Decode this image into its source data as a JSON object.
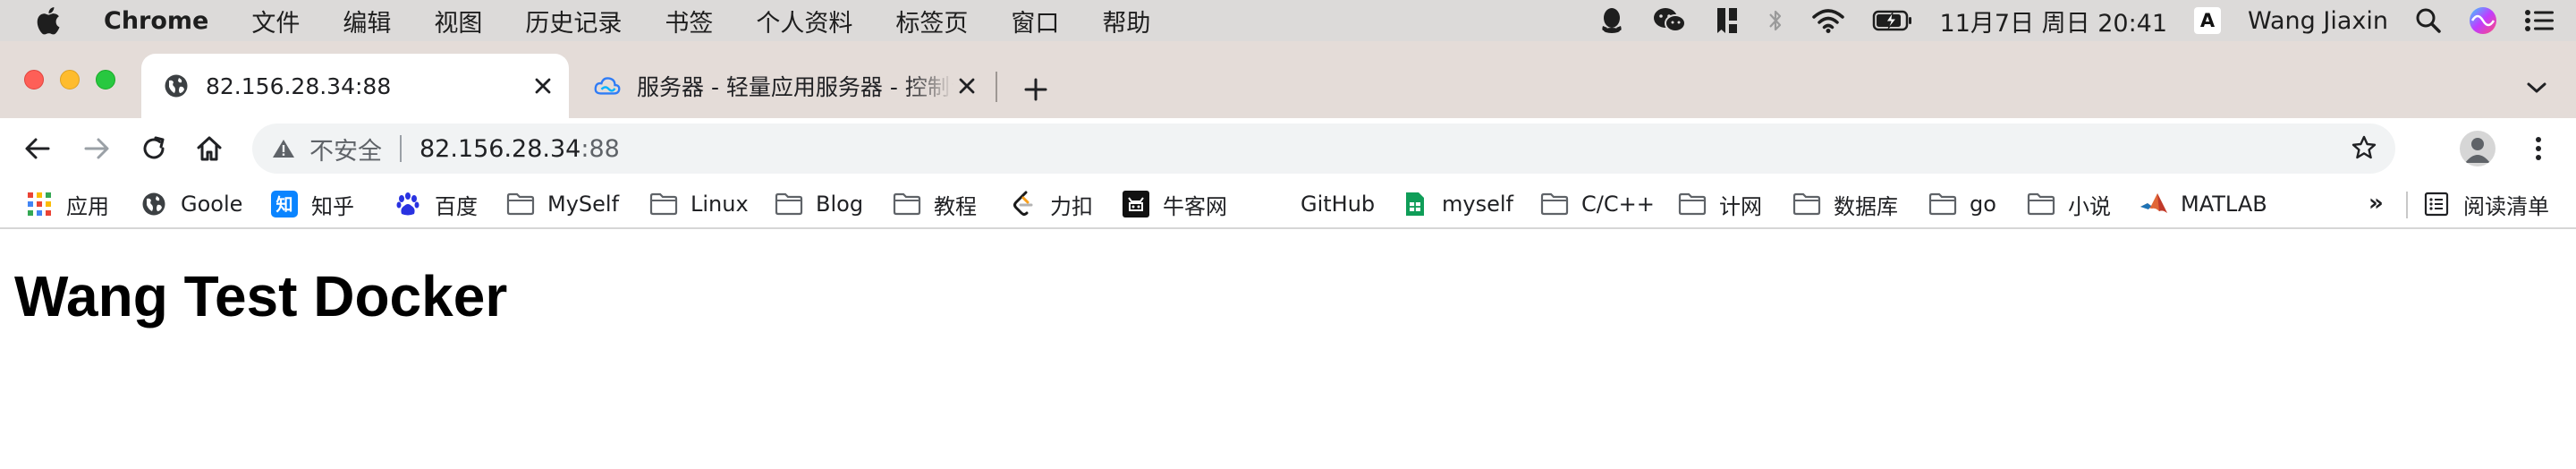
{
  "menubar": {
    "app_name": "Chrome",
    "items": [
      "文件",
      "编辑",
      "视图",
      "历史记录",
      "书签",
      "个人资料",
      "标签页",
      "窗口",
      "帮助"
    ],
    "datetime": "11月7日 周日  20:41",
    "ime_label": "A",
    "user_name": "Wang Jiaxin"
  },
  "tabs": [
    {
      "title": "82.156.28.34:88",
      "active": true
    },
    {
      "title": "服务器 - 轻量应用服务器 - 控制台",
      "active": false
    }
  ],
  "toolbar": {
    "security_label": "不安全",
    "url_host": "82.156.28.34",
    "url_port": ":88"
  },
  "bookmarks": {
    "items": [
      {
        "label": "应用",
        "icon": "apps-grid-icon"
      },
      {
        "label": "Goole",
        "icon": "globe-icon"
      },
      {
        "label": "知乎",
        "icon": "zhihu-icon"
      },
      {
        "label": "百度",
        "icon": "baidu-paw-icon"
      },
      {
        "label": "MySelf",
        "icon": "folder-icon"
      },
      {
        "label": "Linux",
        "icon": "folder-icon"
      },
      {
        "label": "Blog",
        "icon": "folder-icon"
      },
      {
        "label": "教程",
        "icon": "folder-icon"
      },
      {
        "label": "力扣",
        "icon": "leetcode-icon"
      },
      {
        "label": "牛客网",
        "icon": "nowcoder-icon"
      },
      {
        "label": "GitHub",
        "icon": "github-icon"
      },
      {
        "label": "myself",
        "icon": "sheets-icon"
      },
      {
        "label": "C/C++",
        "icon": "folder-icon"
      },
      {
        "label": "计网",
        "icon": "folder-icon"
      },
      {
        "label": "数据库",
        "icon": "folder-icon"
      },
      {
        "label": "go",
        "icon": "folder-icon"
      },
      {
        "label": "小说",
        "icon": "folder-icon"
      },
      {
        "label": "MATLAB",
        "icon": "matlab-icon"
      }
    ],
    "more_label": "»",
    "reading_list_label": "阅读清单"
  },
  "page": {
    "heading": "Wang Test Docker"
  },
  "colors": {
    "menubar_bg": "#dcdad9",
    "tabstrip_bg": "#e4dcd8",
    "omnibox_bg": "#f1f3f4",
    "close_red": "#fe5f57",
    "minimize_yellow": "#febc2e",
    "zoom_green": "#28c840"
  }
}
